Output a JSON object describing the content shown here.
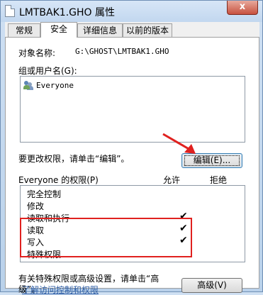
{
  "window": {
    "title": "LMTBAK1.GHO 属性",
    "close_label": "x"
  },
  "tabs": [
    {
      "label": "常规"
    },
    {
      "label": "安全"
    },
    {
      "label": "详细信息"
    },
    {
      "label": "以前的版本"
    }
  ],
  "security": {
    "object_name_label": "对象名称:",
    "object_name_value": "G:\\GHOST\\LMTBAK1.GHO",
    "groups_label": "组或用户名(G):",
    "groups": [
      {
        "name": "Everyone",
        "icon": "users-icon"
      }
    ],
    "change_hint": "要更改权限，请单击“编辑”。",
    "edit_button": "编辑(E)...",
    "permissions_header": "Everyone 的权限(P)",
    "allow_header": "允许",
    "deny_header": "拒绝",
    "permissions": [
      {
        "name": "完全控制",
        "allow": "",
        "deny": ""
      },
      {
        "name": "修改",
        "allow": "",
        "deny": ""
      },
      {
        "name": "读取和执行",
        "allow": "✔",
        "deny": ""
      },
      {
        "name": "读取",
        "allow": "✔",
        "deny": ""
      },
      {
        "name": "写入",
        "allow": "✔",
        "deny": ""
      },
      {
        "name": "特殊权限",
        "allow": "",
        "deny": ""
      }
    ],
    "advanced_hint_line1": "有关特殊权限或高级设置，请单击“高",
    "advanced_hint_line2": "级”。",
    "advanced_button": "高级(V)",
    "learn_more_link": "了解访问控制和权限"
  },
  "colors": {
    "highlight_box": "#e0211f",
    "arrow": "#e0211f"
  }
}
